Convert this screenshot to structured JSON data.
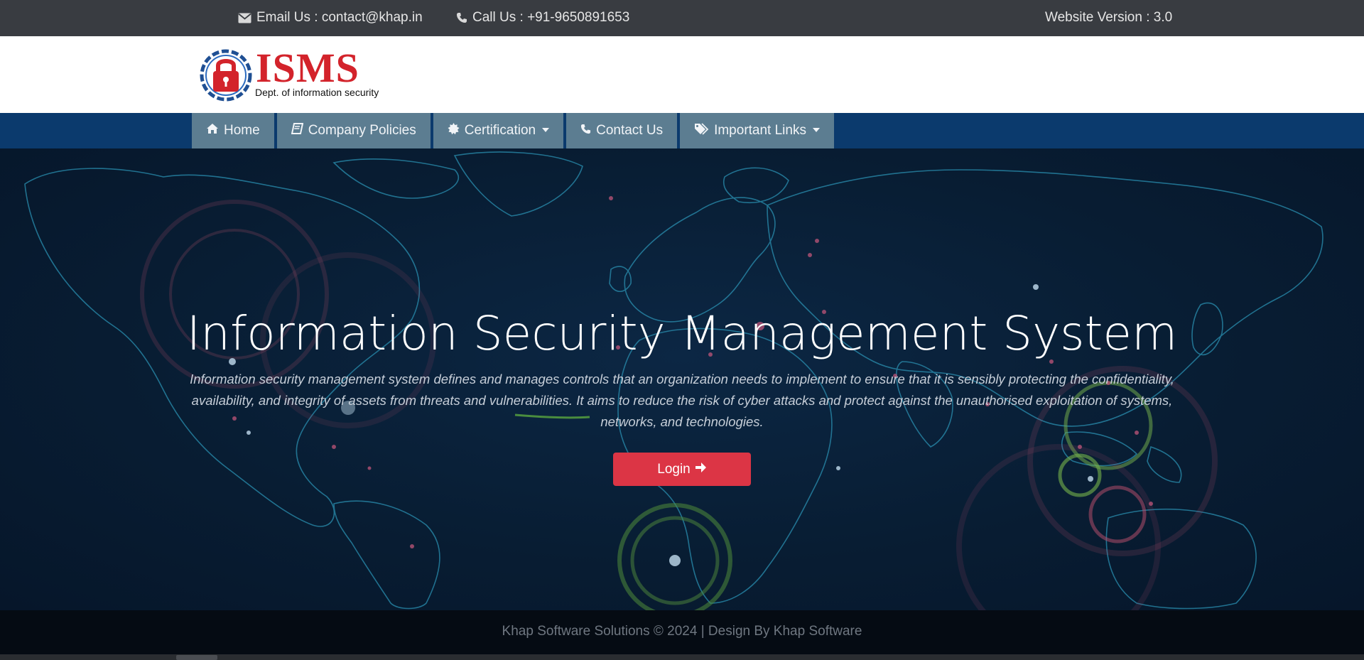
{
  "topbar": {
    "email": "Email Us : contact@khap.in",
    "phone": "Call Us : +91-9650891653",
    "version": "Website Version : 3.0"
  },
  "logo": {
    "title": "ISMS",
    "subtitle": "Dept. of information security"
  },
  "nav": {
    "items": [
      {
        "label": "Home",
        "icon": "home-icon"
      },
      {
        "label": "Company Policies",
        "icon": "book-icon"
      },
      {
        "label": "Certification",
        "icon": "certificate-icon",
        "dropdown": true
      },
      {
        "label": "Contact Us",
        "icon": "phone-icon"
      },
      {
        "label": "Important Links",
        "icon": "tags-icon",
        "dropdown": true
      }
    ]
  },
  "hero": {
    "title": "Information Security Management System",
    "description": "Information security management system defines and manages controls that an organization needs to implement to ensure that it is sensibly protecting the confidentiality, availability, and integrity of assets from threats and vulnerabilities. It aims to reduce the risk of cyber attacks and protect against the unauthorised exploitation of systems, networks, and technologies.",
    "login_label": "Login"
  },
  "footer": {
    "text": "Khap Software Solutions © 2024 | Design By Khap Software"
  },
  "colors": {
    "topbar": "#393c41",
    "navbar": "#0b3a6d",
    "nav_item": "#5c7d91",
    "accent_red": "#dc3545",
    "logo_red": "#d3232b"
  }
}
